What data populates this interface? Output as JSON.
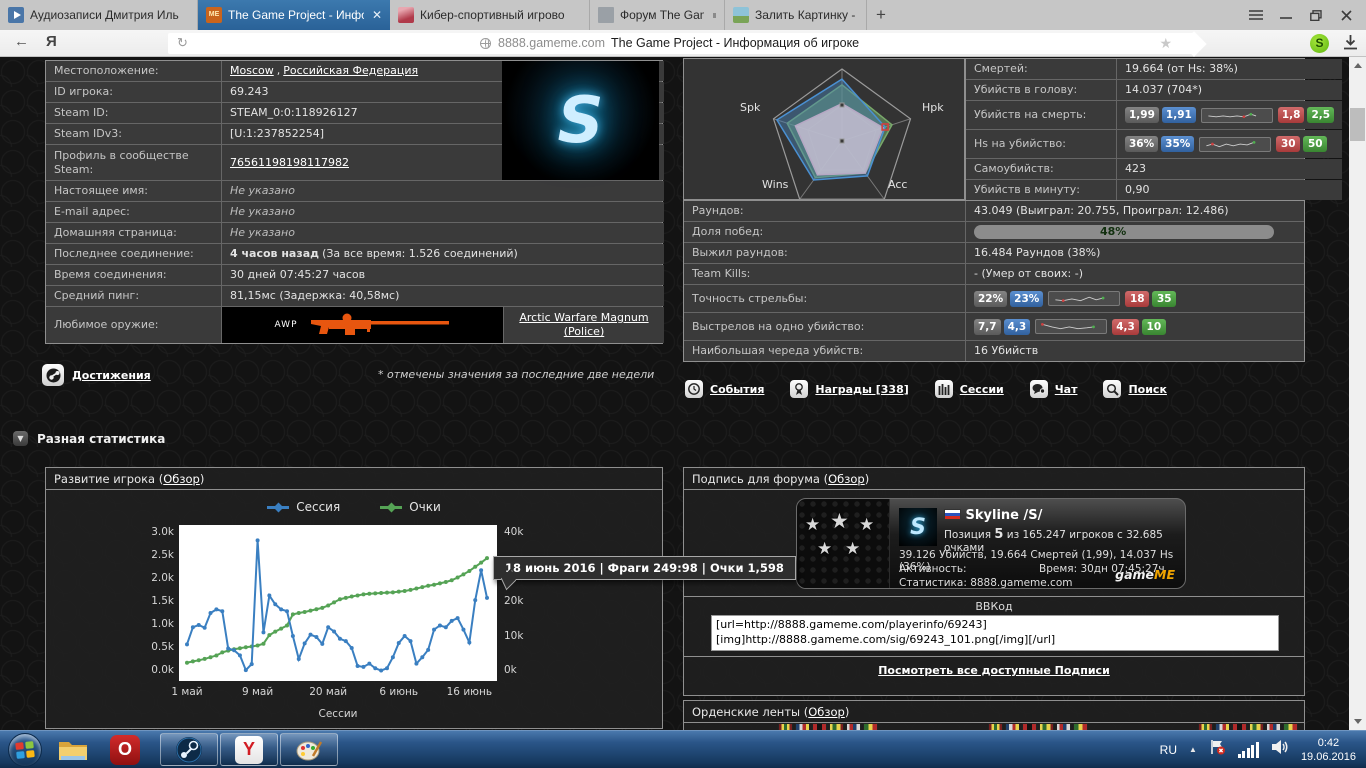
{
  "browser": {
    "tabs": [
      {
        "title": "Аудиозаписи Дмитрия Иль"
      },
      {
        "title": "The Game Project - Инфо"
      },
      {
        "title": "Кибер-спортивный игрово"
      },
      {
        "title": "Форум The Game project"
      },
      {
        "title": "Залить Картинку - Загрузит"
      }
    ],
    "tab_close": "✕",
    "new_tab": "+",
    "address": {
      "url": "8888.gameme.com",
      "title": "The Game Project - Информация об игроке"
    }
  },
  "glyphs": {
    "back": "←",
    "reload": "↻",
    "yandex": "Я",
    "star": "★",
    "ext_badge": "S",
    "me": "ME",
    "tray_arrow": "▲",
    "opera": "O",
    "yandex_task": "Y",
    "collapse": "▼"
  },
  "player_info": {
    "loc_label": "Местоположение:",
    "loc_city": "Moscow",
    "loc_sep": ", ",
    "loc_country": "Российская Федерация",
    "id_label": "ID игрока:",
    "id_value": "69.243",
    "steam_label": "Steam ID:",
    "steam_value": "STEAM_0:0:118926127",
    "steam3_label": "Steam IDv3:",
    "steam3_value": "[U:1:237852254]",
    "profile_label": "Профиль в сообществе Steam:",
    "profile_value": "76561198198117982",
    "name_label": "Настоящее имя:",
    "name_value": "Не указано",
    "email_label": "E-mail адрес:",
    "email_value": "Не указано",
    "home_label": "Домашняя страница:",
    "home_value": "Не указано",
    "lastconn_label": "Последнее соединение:",
    "lastconn_bold": "4 часов назад",
    "lastconn_rest": " (За все время: 1.526 соединений)",
    "conntime_label": "Время соединения:",
    "conntime_value": "30 дней 07:45:27 часов",
    "ping_label": "Средний пинг:",
    "ping_value": "81,15мс (Задержка: 40,58мс)",
    "weapon_label": "Любимое оружие:",
    "weapon_name": "AWP",
    "weapon_link": "Arctic Warfare Magnum (Police)",
    "avatar_letter": "S"
  },
  "achievements": {
    "label": "Достижения",
    "note": "* отмечены значения за последние две недели"
  },
  "section": {
    "title": "Разная статистика"
  },
  "stats_right": {
    "deaths_label": "Смертей:",
    "deaths_value": "19.664 (от Hs: 38%)",
    "hs_label": "Убийств в голову:",
    "hs_value": "14.037 (704*)",
    "kpd_label": "Убийств на смерть:",
    "kpd_b1": "1,99",
    "kpd_b2": "1,91",
    "kpd_b3": "1,8",
    "kpd_b4": "2,5",
    "hpk_label": "Hs на убийство:",
    "hpk_b1": "36%",
    "hpk_b2": "35%",
    "hpk_b3": "30",
    "hpk_b4": "50",
    "suicides_label": "Самоубийств:",
    "suicides_value": "423",
    "kpm_label": "Убийств в минуту:",
    "kpm_value": "0,90"
  },
  "stats_full": {
    "rounds_label": "Раундов:",
    "rounds_value": "43.049 (Выиграл: 20.755, Проиграл: 12.486)",
    "winrate_label": "Доля побед:",
    "winrate_value": "48%",
    "winrate_style": "width:48%",
    "survived_label": "Выжил раундов:",
    "survived_value": "16.484 Раундов (38%)",
    "tk_label": "Team Kills:",
    "tk_value": "- (Умер от своих: -)",
    "acc_label": "Точность стрельбы:",
    "acc_b1": "22%",
    "acc_b2": "23%",
    "acc_b3": "18",
    "acc_b4": "35",
    "spk_label": "Выстрелов на одно убийство:",
    "spk_b1": "7,7",
    "spk_b2": "4,3",
    "spk_b3": "4,3",
    "spk_b4": "10",
    "streak_label": "Наибольшая череда убийств:",
    "streak_value": "16 Убийств"
  },
  "quick_links": {
    "items": [
      "События",
      "Награды [338]",
      "Сессии",
      "Чат",
      "Поиск"
    ]
  },
  "panels": {
    "chart": {
      "pre": "Развитие игрока (",
      "link": "Обзор",
      "post": ")"
    },
    "sig": {
      "pre": "Подпись для форума (",
      "link": "Обзор",
      "post": ")"
    },
    "ribbons": {
      "pre": "Орденские ленты (",
      "link": "Обзор",
      "post": ")"
    }
  },
  "chart_data": [
    {
      "type": "line",
      "title": "Развитие игрока",
      "xlabel": "Сессии",
      "legend": [
        "Сессия",
        "Очки"
      ],
      "x_ticks": [
        "1 май",
        "9 май",
        "20 май",
        "6 июнь",
        "16 июнь"
      ],
      "x_tick_indices": [
        0,
        12,
        24,
        36,
        48
      ],
      "y_left": {
        "ticks": [
          "3.0k",
          "2.5k",
          "2.0k",
          "1.5k",
          "1.0k",
          "0.5k",
          "0.0k"
        ],
        "range": [
          0,
          3000
        ]
      },
      "y_right": {
        "ticks": [
          "40k",
          "30k",
          "20k",
          "10k",
          "0k"
        ],
        "range": [
          0,
          40000
        ]
      },
      "series": [
        {
          "name": "Очки",
          "color": "#55a355",
          "axis": "right",
          "values": [
            2400,
            2800,
            3100,
            3500,
            4000,
            4500,
            5400,
            5900,
            6300,
            6600,
            6900,
            7100,
            7400,
            7900,
            10400,
            11400,
            12300,
            13200,
            16400,
            16800,
            17100,
            17500,
            17900,
            18300,
            19000,
            19900,
            20800,
            21200,
            21600,
            21900,
            22200,
            22400,
            22500,
            22600,
            22700,
            22800,
            23000,
            23200,
            23500,
            23900,
            24300,
            24700,
            25000,
            25400,
            25800,
            26300,
            27100,
            28000,
            29000,
            30200,
            31400,
            32700
          ]
        },
        {
          "name": "Сессия",
          "color": "#3a7fc1",
          "axis": "left",
          "values": [
            580,
            950,
            1000,
            940,
            1260,
            1340,
            1300,
            490,
            450,
            340,
            20,
            150,
            2840,
            840,
            1640,
            1450,
            1340,
            1300,
            760,
            260,
            600,
            790,
            740,
            590,
            950,
            860,
            700,
            650,
            500,
            110,
            90,
            160,
            60,
            10,
            60,
            300,
            610,
            760,
            650,
            160,
            300,
            460,
            900,
            990,
            950,
            1090,
            1150,
            900,
            620,
            1540,
            2190,
            1590
          ]
        }
      ],
      "tooltip": "18 июнь 2016 | Фраги 249:98 | Очки 1,598"
    },
    {
      "type": "radar",
      "axis_labels": [
        "Spk",
        "Hpk",
        "Wins",
        "Acc"
      ],
      "axes_order": [
        "top",
        "hpk",
        "acc",
        "wins",
        "spk"
      ],
      "series": [
        {
          "name": "green",
          "stroke": "#79a96a",
          "fill": "rgba(115,170,110,0.55)",
          "values": [
            0.78,
            0.73,
            0.55,
            0.63,
            0.8
          ]
        },
        {
          "name": "blue",
          "stroke": "#4a90d2",
          "fill": "rgba(70,130,185,0.45)",
          "values": [
            0.86,
            0.63,
            0.6,
            0.67,
            0.95
          ]
        },
        {
          "name": "lavender",
          "stroke": "#b6a8c4",
          "fill": "rgba(205,195,215,0.8)",
          "values": [
            0.52,
            0.6,
            0.55,
            0.58,
            0.68
          ]
        }
      ],
      "marker": {
        "axis_index": 1,
        "frac": 0.63,
        "color": "#d04040"
      }
    }
  ],
  "signature": {
    "name": "Skyline /S/",
    "position_pre": "Позиция ",
    "position_num": "5",
    "position_post": " из 165.247 игроков с 32.685 очками",
    "stats_line": "39.126 Убийств, 19.664 Смертей (1,99), 14.037 Hs (36%)",
    "activity_label": "Активность:",
    "time_value": "Время: 30дн 07:45:27ч",
    "host_line": "Статистика: 8888.gameme.com",
    "brand_game": "game",
    "brand_me": "ME",
    "bbcode_label": "ВВКод",
    "bbcode": "[url=http://8888.gameme.com/playerinfo/69243]\n[img]http://8888.gameme.com/sig/69243_101.png[/img][/url]",
    "view_all": "Посмотреть все доступные Подписи",
    "avatar_letter": "S"
  },
  "ribbons_data": {
    "group_lefts": [
      94,
      304,
      514
    ],
    "chips": [
      "linear-gradient(90deg,#7a1f1f 18%,#e8d44d 18% 38%,#2e6b2e 38% 62%,#e8d44d 62% 82%,#7a1f1f 82%)",
      "linear-gradient(90deg,#20406b 25%,#d8d8d8 25% 50%,#b02a2a 50% 75%,#e8d44d 75%)",
      "linear-gradient(90deg,#b02a2a 30%,#111 30% 70%,#b02a2a 70%)",
      "linear-gradient(90deg,#e8d44d 20%,#2e6b2e 20% 50%,#e8d44d 50% 80%,#7a1f1f 80%)",
      "linear-gradient(90deg,#d8d8d8 20%,#b02a2a 20% 45%,#20406b 45% 75%,#d8d8d8 75%)",
      "linear-gradient(90deg,#2e6b2e 33%,#e8d44d 33% 66%,#b02a2a 66%)"
    ]
  },
  "taskbar": {
    "lang": "RU",
    "time": "0:42",
    "date": "19.06.2016"
  }
}
